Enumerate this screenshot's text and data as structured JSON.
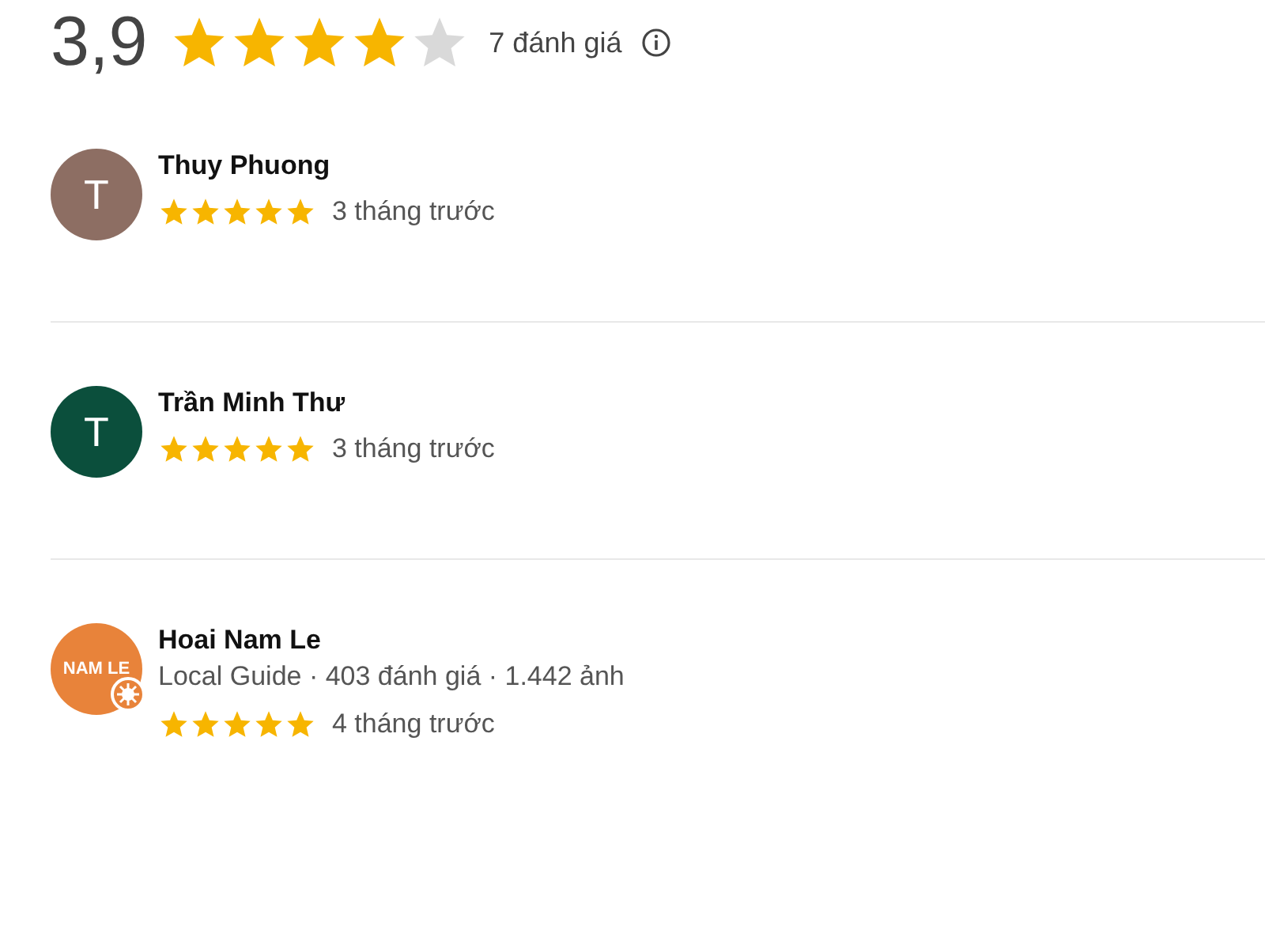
{
  "summary": {
    "score": "3,9",
    "stars": 4,
    "count": "7 đánh giá"
  },
  "reviews": [
    {
      "avatar": "T",
      "color": "#8d6e63",
      "name": "Thuy Phuong",
      "stars": 5,
      "time": "3 tháng trước"
    },
    {
      "avatar": "T",
      "color": "#0b4f3c",
      "name": "Trần Minh Thư",
      "stars": 5,
      "time": "3 tháng trước"
    },
    {
      "avatar": "NAM LE",
      "color": "#e8833a",
      "name": "Hoai Nam Le",
      "details": "Local Guide · 403 đánh giá · 1.442 ảnh",
      "local_guide": true,
      "stars": 5,
      "time": "4 tháng trước"
    }
  ]
}
